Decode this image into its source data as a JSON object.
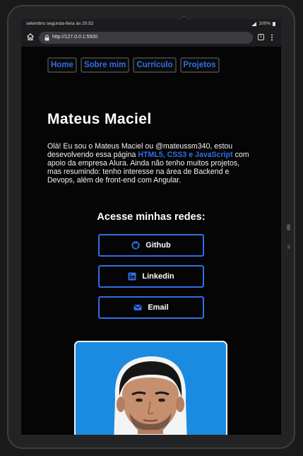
{
  "statusbar": {
    "time": "setembro segunda-feira às 20:52",
    "battery": "100%"
  },
  "browser": {
    "url": "http://127.0.0.1:5500",
    "tab_count": "1"
  },
  "nav": {
    "items": [
      {
        "label": "Home"
      },
      {
        "label": "Sobre mim"
      },
      {
        "label": "Currículo"
      },
      {
        "label": "Projetos"
      }
    ]
  },
  "profile": {
    "name": "Mateus Maciel",
    "intro_before": "Olá! Eu sou o Mateus Maciel ou @mateussm340, estou desevolvendo essa página ",
    "intro_highlight": "HTML5, CSS3 e JavaScript",
    "intro_after": " com apoio da empresa Alura. Ainda não tenho muitos projetos, mas resumindo: tenho interesse na área de Backend e Devops, além de front-end com Angular."
  },
  "social": {
    "heading": "Acesse minhas redes:",
    "github_label": "Github",
    "linkedin_label": "Linkedin",
    "email_label": "Email"
  },
  "colors": {
    "accent": "#2f6fe6",
    "background": "#050505",
    "photo_background": "#1a8be0"
  },
  "icons": {
    "github": "github-icon",
    "linkedin": "linkedin-icon",
    "email": "email-icon",
    "home": "home-icon",
    "lock": "lock-icon",
    "menu": "more-vertical-icon"
  }
}
